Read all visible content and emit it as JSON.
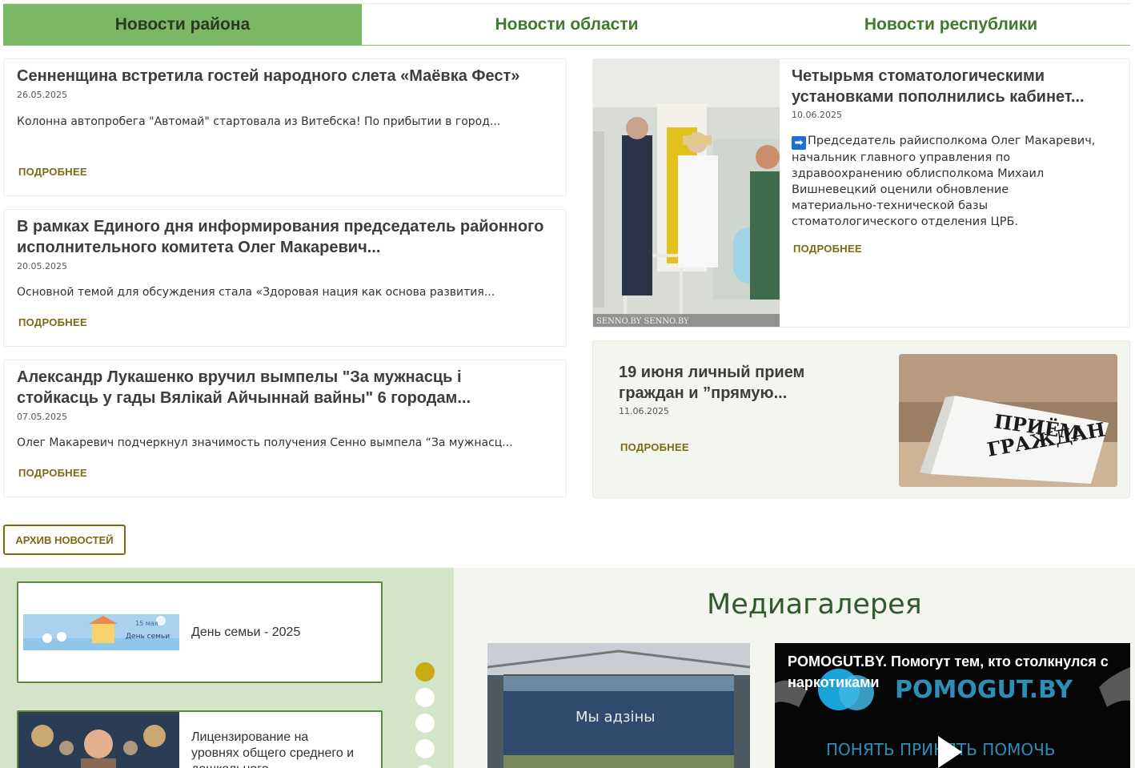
{
  "tabs": [
    {
      "label": "Новости района",
      "active": true
    },
    {
      "label": "Новости области",
      "active": false
    },
    {
      "label": "Новости республики",
      "active": false
    }
  ],
  "news": [
    {
      "title": "Сенненщина встретила гостей народного слета «Маёвка Фест»",
      "date": "26.05.2025",
      "excerpt": "Колонна автопробега \"Автомай\" стартовала из Витебска! По прибытии в город..."
    },
    {
      "title": "В рамках Единого дня информирования председатель районного исполнительного комитета Олег Макаревич...",
      "date": "20.05.2025",
      "excerpt": "Основной темой для обсуждения стала «Здоровая нация как основа развития..."
    },
    {
      "title": "Александр Лукашенко вручил вымпелы \"За мужнасць і стойкасць у гады Вялікай Айчыннай вайны\" 6 городам...",
      "date": "07.05.2025",
      "excerpt": "Олег Макаревич подчеркнул значимость получения Сенно вымпела “За мужнасц..."
    }
  ],
  "more_label": "ПОДРОБНЕЕ",
  "featured": {
    "title": "Четырьмя стоматологическими установками пополнились кабинет...",
    "date": "10.06.2025",
    "arrow_icon": "➡",
    "text": "Председатель райисполкома Олег Макаревич, начальник главного управления по здравоохранению облисполкома Михаил Вишневецкий оценили обновление материально-технической базы стоматологического отделения ЦРБ.",
    "watermark": "SENNO.BY   SENNO.BY"
  },
  "reception": {
    "title": "19 июня личный прием граждан и ”прямую...",
    "date": "11.06.2025",
    "sign_line1": "ПРИЁМ",
    "sign_line2": "ГРАЖДАН"
  },
  "archive_label": "АРХИВ НОВОСТЕЙ",
  "banners": [
    {
      "text": "День семьи - 2025",
      "image_caption": "15 мая",
      "image_subcaption": "День семьи"
    },
    {
      "text": "Лицензирование на уровнях общего среднего и дошкольного"
    }
  ],
  "slider": {
    "dots": 5,
    "active_index": 0
  },
  "media": {
    "title": "Медиагалерея",
    "photo_caption": "Мы адзіны",
    "video_title": "POMOGUT.BY. Помогут тем, кто столкнулся с наркотиками",
    "video_logo": "POMOGUT.BY",
    "video_slogan": "ПОНЯТЬ ПРИНЯТЬ ПОМОЧЬ"
  },
  "colors": {
    "tab_active": "#7ab866",
    "tab_text": "#3f7a2c",
    "accent_gold": "#7b6a14",
    "dot_active": "#c9ac12",
    "panel_green": "#d3e4c8"
  }
}
